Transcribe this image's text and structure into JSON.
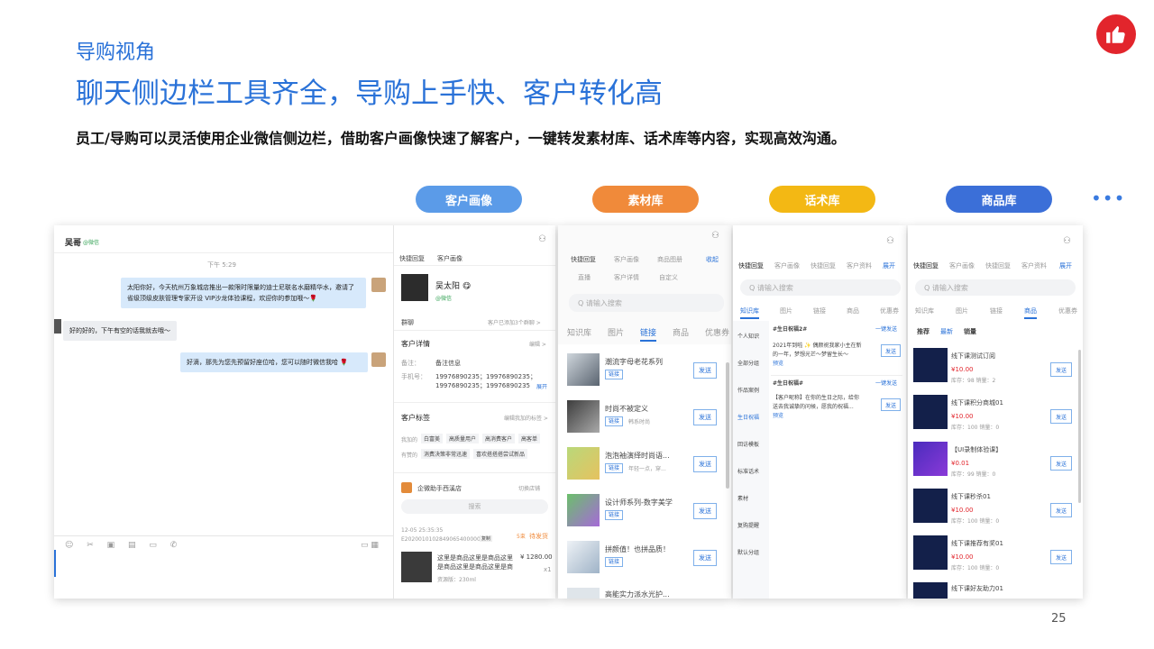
{
  "slide": {
    "kicker": "导购视角",
    "title": "聊天侧边栏工具齐全，导购上手快、客户转化高",
    "desc": "员工/导购可以灵活使用企业微信侧边栏，借助客户画像快速了解客户，一键转发素材库、话术库等内容，实现高效沟通。",
    "page": "25",
    "more": "•••"
  },
  "pills": [
    "客户画像",
    "素材库",
    "话术库",
    "商品库"
  ],
  "chat": {
    "name": "吴哥",
    "source": "@微信",
    "time": "下午 5:29",
    "m1": "太阳你好，今天杭州万象城店推出一款限时限量的迪士尼联名水磨精华水，邀请了省级顶级皮肤管理专家开设 VIP沙龙体验课程，欢迎你的参加哦～🌹",
    "m2": "好的好的，下午有空的话我就去哦～",
    "m3": "好滴，那先为您先预留好座位哈，您可以随时微信我哈 🌹"
  },
  "profile": {
    "tab1": "快捷回复",
    "tab2": "客户画像",
    "name": "吴太阳 😋",
    "source": "@微信",
    "group_label": "群聊",
    "group_val": "客户已添加3个群聊 >",
    "detail_title": "客户详情",
    "edit": "编辑 >",
    "note_label": "备注：",
    "note_val": "备注信息",
    "phone_label": "手机号：",
    "phone1": "19976890235；19976890235；",
    "phone2": "19976890235；19976890235",
    "expand": "展开",
    "tag_title": "客户标签",
    "tag_edit": "编辑我加的标签 >",
    "row1_label": "我加的",
    "row1": [
      "白富美",
      "高质量用户",
      "高消费客户",
      "高客单"
    ],
    "row2_label": "有赞的",
    "row2": [
      "消费决策非常迅速",
      "喜欢搭搭搭尝试新品"
    ],
    "store": "企微助手西溪店",
    "switch": "切换店铺",
    "search": "搜索",
    "order_time": "12-05 25:35:35",
    "order_id": "E20200101028490654000003",
    "copy": "复制",
    "order_count": "5束",
    "order_status": "待发货",
    "order_desc1": "这里是商品这里是商品这里",
    "order_desc2": "是商品这里是商品这里是商",
    "order_price": "¥ 1280.00",
    "order_qty": "x1",
    "order_spec": "资源版：230ml"
  },
  "material": {
    "tabs1": [
      "快捷回复",
      "客户画像",
      "商品图册"
    ],
    "collapse": "收起",
    "tabs2": [
      "直播",
      "客户详情",
      "自定义"
    ],
    "search": "Q  请输入搜索",
    "tabs3": [
      "知识库",
      "图片",
      "链接",
      "商品",
      "优惠券"
    ],
    "active": "链接",
    "items": [
      {
        "title": "潮流字母老花系列",
        "desc": ""
      },
      {
        "title": "时尚不被定义",
        "desc": "韩系时尚"
      },
      {
        "title": "泡泡袖演绎时尚语...",
        "desc": "年轻一点，穿..."
      },
      {
        "title": "设计师系列-数字美学",
        "desc": ""
      },
      {
        "title": "拼颜值！也拼品质！",
        "desc": ""
      },
      {
        "title": "高能实力派水光护...",
        "desc": ""
      }
    ],
    "tag": "链接",
    "send": "发送"
  },
  "script": {
    "tabs": [
      "快捷回复",
      "客户画像",
      "快捷回复",
      "客户资料"
    ],
    "expand": "展开",
    "search": "Q  请输入搜索",
    "tabs2": [
      "知识库",
      "图片",
      "链接",
      "商品",
      "优惠券"
    ],
    "cats": [
      "个人知识",
      "全部分组",
      "作品案例",
      "生日祝福",
      "回访模板",
      "标准话术",
      "素材",
      "复购提醒",
      "默认分组"
    ],
    "card1_title": "#生日祝福2#",
    "card1_action": "一键发送",
    "card1_text1": "2021年到啦 ✨ 偶颜祝我家小主在新",
    "card1_text2": "的一年，梦想光芒～梦留生长～",
    "card1_more": "预览",
    "card2_title": "#生日祝福#",
    "card2_action": "一键发送",
    "card2_text1": "【客户昵称】在你的生日之际，给你",
    "card2_text2": "送去我诚挚的问候，愿我的祝福...",
    "card2_more": "预览",
    "send": "发送"
  },
  "goods": {
    "tabs": [
      "快捷回复",
      "客户画像",
      "快捷回复",
      "客户资料"
    ],
    "expand": "展开",
    "search": "Q  请输入搜索",
    "tabs2": [
      "知识库",
      "图片",
      "链接",
      "商品",
      "优惠券"
    ],
    "sort": [
      "推荐",
      "最新",
      "销量"
    ],
    "items": [
      {
        "title": "线下课测试订阅",
        "price": "¥10.00",
        "stock": "库存：98  销量：2"
      },
      {
        "title": "线下课积分商城01",
        "price": "¥10.00",
        "stock": "库存：100  销量：0"
      },
      {
        "title": "【UI录制体验课】",
        "price": "¥0.01",
        "stock": "库存：99  销量：0"
      },
      {
        "title": "线下课秒杀01",
        "price": "¥10.00",
        "stock": "库存：100  销量：0"
      },
      {
        "title": "线下课推荐有奖01",
        "price": "¥10.00",
        "stock": "库存：100  销量：0"
      },
      {
        "title": "线下课好友助力01",
        "price": "",
        "stock": ""
      }
    ],
    "send": "发送"
  },
  "colors": {
    "blue": "#2a72d8",
    "pill1": "#5b9be8",
    "pill2": "#f08a3a",
    "pill3": "#f3b814",
    "pill4": "#3b6fd8",
    "logo": "#e2252c"
  }
}
